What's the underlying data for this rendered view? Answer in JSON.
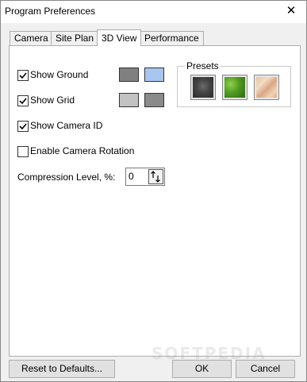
{
  "window": {
    "title": "Program Preferences",
    "close_glyph": "✕"
  },
  "tabs": [
    {
      "label": "Camera",
      "active": false
    },
    {
      "label": "Site Plan",
      "active": false
    },
    {
      "label": "3D View",
      "active": true
    },
    {
      "label": "Performance",
      "active": false
    }
  ],
  "view3d": {
    "show_ground": {
      "label": "Show Ground",
      "checked": true,
      "colors": [
        "#808080",
        "#a7c7f0"
      ]
    },
    "show_grid": {
      "label": "Show Grid",
      "checked": true,
      "colors": [
        "#c2c2c2",
        "#8a8a8a"
      ]
    },
    "show_camera_id": {
      "label": "Show Camera ID",
      "checked": true
    },
    "enable_camera_rotation": {
      "label": "Enable Camera Rotation",
      "checked": false
    },
    "presets": {
      "label": "Presets",
      "items": [
        "asphalt",
        "grass",
        "sand"
      ]
    },
    "compression": {
      "label": "Compression Level, %:",
      "value": "0"
    }
  },
  "footer": {
    "reset_label": "Reset to Defaults...",
    "ok_label": "OK",
    "cancel_label": "Cancel"
  },
  "watermark": "SOFTPEDIA"
}
